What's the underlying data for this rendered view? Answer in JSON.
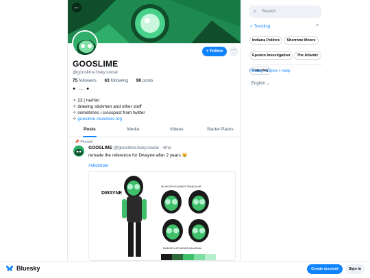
{
  "profile": {
    "name": "GOOSLIME",
    "handle": "@gooslime.bsky.social",
    "followers_count": "75",
    "followers_label": "followers",
    "following_count": "63",
    "following_label": "following",
    "posts_count": "98",
    "posts_label": "posts",
    "dots": "● ... ●",
    "bio_lines": [
      "✧ 23 | he/him",
      "✧ drawing stickmen and other stuff",
      "✧ sometimes i crosspost from twitter"
    ],
    "bio_link_prefix": "✧ ",
    "bio_link": "gooslime.neocities.org",
    "follow_label": "+ Follow",
    "more_label": "⋯",
    "back_label": "←"
  },
  "tabs": [
    "Posts",
    "Media",
    "Videos",
    "Starter Packs"
  ],
  "post": {
    "pinned_label": "Pinned",
    "author_name": "GOOSLIME",
    "author_handle": "@gooslime.bsky.social",
    "age": "· 4mo",
    "text": "remade the reference for Dwayne after 2 years 😸",
    "hashtag": "#stickman",
    "image_text": {
      "character_name": "DWAYNE",
      "mouth_note": "HIS MOUTH IS ALWAYS TRIANGULAR",
      "bandana_note": "DWAYNE ALSO WEARS A BANDANA"
    },
    "palette": [
      "#1a1a1a",
      "#2e6b3c",
      "#3fbf6a",
      "#7fe0a6",
      "#b6f0cf"
    ]
  },
  "sidebar": {
    "search_placeholder": "Search",
    "trending_label": "Trending",
    "close_label": "×",
    "trends": [
      "Indiana Politics",
      "Sherrone Moore",
      "Epstein Investigation",
      "The Atlantic",
      "Caturday"
    ],
    "links": "Privacy • Terms • Help",
    "language": "English",
    "language_caret": "⌄"
  },
  "footer": {
    "brand": "Bluesky",
    "create_label": "Create account",
    "signin_label": "Sign in"
  },
  "colors": {
    "accent": "#1083fe",
    "slime_green": "#2fae6a",
    "banner_green": "#1f8a4f"
  }
}
